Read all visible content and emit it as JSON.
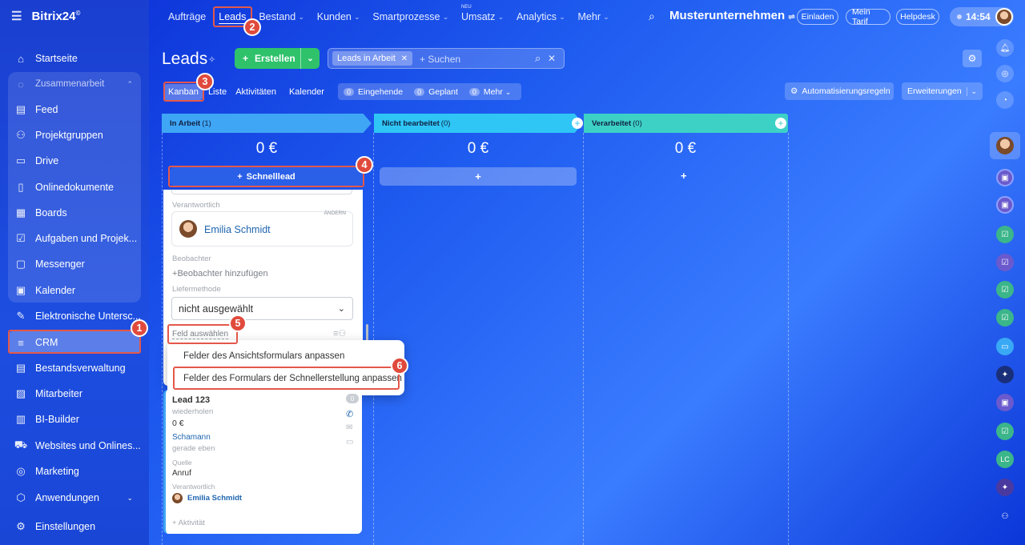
{
  "brand": {
    "name": "Bitrix24",
    "mark": "©"
  },
  "sidebar": {
    "items": [
      {
        "label": "Startseite",
        "icon": "home-icon"
      },
      {
        "label": "Zusammenarbeit",
        "icon": "chat-icon"
      },
      {
        "label": "Feed",
        "icon": "feed-icon"
      },
      {
        "label": "Projektgruppen",
        "icon": "group-icon"
      },
      {
        "label": "Drive",
        "icon": "drive-icon"
      },
      {
        "label": "Onlinedokumente",
        "icon": "document-icon"
      },
      {
        "label": "Boards",
        "icon": "board-icon"
      },
      {
        "label": "Aufgaben und Projek...",
        "icon": "task-icon"
      },
      {
        "label": "Messenger",
        "icon": "messenger-icon"
      },
      {
        "label": "Kalender",
        "icon": "calendar-icon"
      },
      {
        "label": "Elektronische Untersc...",
        "icon": "signature-icon"
      },
      {
        "label": "CRM",
        "icon": "crm-icon"
      },
      {
        "label": "Bestandsverwaltung",
        "icon": "inventory-icon"
      },
      {
        "label": "Mitarbeiter",
        "icon": "employees-icon"
      },
      {
        "label": "BI-Builder",
        "icon": "chart-icon"
      },
      {
        "label": "Websites und Onlines...",
        "icon": "cart-icon"
      },
      {
        "label": "Marketing",
        "icon": "marketing-icon"
      },
      {
        "label": "Anwendungen",
        "icon": "apps-icon"
      },
      {
        "label": "Einstellungen",
        "icon": "settings-icon"
      }
    ]
  },
  "topnav": {
    "items": [
      "Aufträge",
      "Leads",
      "Bestand",
      "Kunden",
      "Smartprozesse",
      "Umsatz",
      "Analytics",
      "Mehr"
    ],
    "new_badge": "NEU",
    "company": "Musterunternehmen",
    "invite": "Einladen",
    "tariff": "Mein Tarif",
    "helpdesk": "Helpdesk",
    "time": "14:54"
  },
  "page": {
    "title": "Leads",
    "create_label": "Erstellen",
    "filter_tag": "Leads in Arbeit",
    "search_placeholder": "+ Suchen",
    "automation_label": "Automatisierungsregeln",
    "extensions_label": "Erweiterungen"
  },
  "views": {
    "tabs": [
      "Kanban",
      "Liste",
      "Aktivitäten",
      "Kalender"
    ],
    "counters": [
      {
        "count": "0",
        "label": "Eingehende"
      },
      {
        "count": "0",
        "label": "Geplant"
      },
      {
        "count": "0",
        "label": "Mehr"
      }
    ]
  },
  "kanban": {
    "columns": [
      {
        "title": "In Arbeit",
        "count": "(1)",
        "sum": "0 €",
        "color": "#3fa6f5"
      },
      {
        "title": "Nicht bearbeitet",
        "count": "(0)",
        "sum": "0 €",
        "color": "#2fc6f6"
      },
      {
        "title": "Verarbeitet",
        "count": "(0)",
        "sum": "0 €",
        "color": "#3dd1c6"
      }
    ],
    "quick_lead_label": "Schnelllead",
    "quick_plus": "+"
  },
  "form": {
    "responsible_label": "Verantwortlich",
    "change_label": "ÄNDERN",
    "responsible_name": "Emilia Schmidt",
    "observers_label": "Beobachter",
    "add_observer": "Beobachter hinzufügen",
    "delivery_label": "Liefermethode",
    "delivery_value": "nicht ausgewählt",
    "select_field": "Feld auswählen"
  },
  "menu": {
    "items": [
      "Felder des Ansichtsformulars anpassen",
      "Felder des Formulars der Schnellerstellung anpassen"
    ]
  },
  "lead_card": {
    "title": "Lead 123",
    "repeat": "wiederholen",
    "amount": "0 €",
    "contact": "Schamann",
    "time": "gerade eben",
    "source_label": "Quelle",
    "source_value": "Anruf",
    "responsible_label": "Verantwortlich",
    "responsible_name": "Emilia Schmidt",
    "activity": "+ Aktivität",
    "count": "0"
  },
  "steps": [
    "1",
    "2",
    "3",
    "4",
    "5",
    "6"
  ],
  "colors": {
    "accent_red": "#e4584a",
    "green": "#2fc26b",
    "link": "#2066b0"
  }
}
